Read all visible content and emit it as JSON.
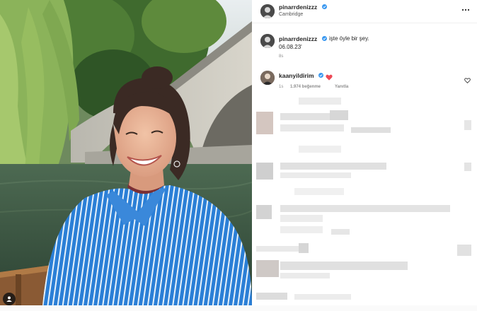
{
  "post": {
    "author": {
      "username": "pinarrdenizzz",
      "verified": true
    },
    "location": "Cambridge",
    "more_icon": "more-horizontal-icon"
  },
  "caption": {
    "username": "pinarrdenizzz",
    "text": "işte öyle bir şey.",
    "date_line": "06.08.23'",
    "time_ago": "8s"
  },
  "comments": [
    {
      "username": "kaanyildirim",
      "verified": true,
      "emoji": "red-heart",
      "time_ago": "1s",
      "likes": "1.974 beğenme",
      "reply_label": "Yanıtla"
    }
  ],
  "colors": {
    "verified_blue": "#3897f0",
    "heart_red": "#ed4956",
    "shirt_blue": "#2a7fd4"
  }
}
